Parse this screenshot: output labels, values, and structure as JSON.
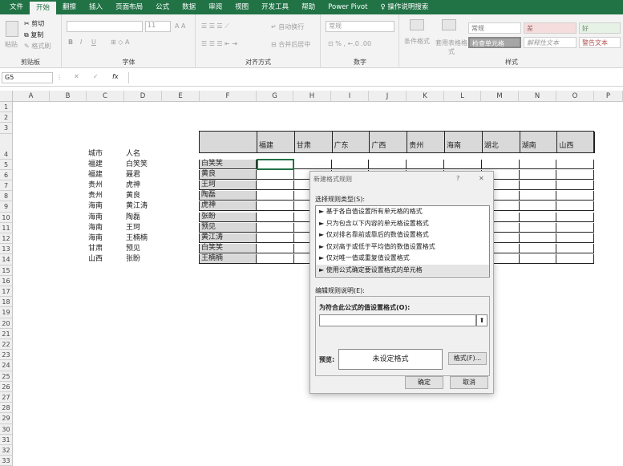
{
  "tabs": [
    "文件",
    "开始",
    "翻擦",
    "插入",
    "页面布局",
    "公式",
    "数据",
    "审阅",
    "视图",
    "开发工具",
    "帮助",
    "Power Pivot",
    "操作说明搜索"
  ],
  "clipboard": {
    "paste": "粘贴",
    "cut": "剪切",
    "copy": "复制",
    "format_painter": "格式刷",
    "label": "剪贴板"
  },
  "font": {
    "label": "字体",
    "size": "11",
    "bold": "B",
    "italic": "I",
    "underline": "U"
  },
  "alignment": {
    "label": "对齐方式",
    "wrap": "自动换行",
    "merge": "合并后居中"
  },
  "number": {
    "label": "数字",
    "format": "常规"
  },
  "styles": {
    "cond_format": "条件格式",
    "table_format": "套用表格格式",
    "label": "样式",
    "boxes": [
      "常规",
      "差",
      "好",
      "检查单元格",
      "解释性文本",
      "警告文本"
    ]
  },
  "formula_bar": {
    "name_box": "G5",
    "fx": "fx"
  },
  "columns": [
    "A",
    "B",
    "C",
    "D",
    "E",
    "F",
    "G",
    "H",
    "I",
    "J",
    "K",
    "L",
    "M",
    "N",
    "O",
    "P"
  ],
  "rows": [
    "1",
    "2",
    "3",
    "4",
    "5",
    "6",
    "7",
    "8",
    "9",
    "10",
    "11",
    "12",
    "13",
    "14",
    "15",
    "16",
    "17",
    "18",
    "19",
    "20",
    "21",
    "22",
    "23",
    "24",
    "25",
    "26",
    "27",
    "28",
    "29",
    "30",
    "31",
    "32",
    "33"
  ],
  "cd_header": {
    "city": "城市",
    "name": "人名"
  },
  "cd_rows": [
    [
      "福建",
      "白笑笑"
    ],
    [
      "福建",
      "聂君"
    ],
    [
      "贵州",
      "虎神"
    ],
    [
      "贵州",
      "黄良"
    ],
    [
      "海南",
      "黄江涛"
    ],
    [
      "海南",
      "陶磊"
    ],
    [
      "海南",
      "王珂"
    ],
    [
      "海南",
      "王楠楠"
    ],
    [
      "甘肃",
      "预见"
    ],
    [
      "山西",
      "张盼"
    ]
  ],
  "matrix_header": [
    "福建",
    "甘肃",
    "广东",
    "广西",
    "贵州",
    "海南",
    "湖北",
    "湖南",
    "山西"
  ],
  "matrix_names": [
    "白笑笑",
    "黄良",
    "王珂",
    "陶磊",
    "虎神",
    "张盼",
    "预见",
    "黄江涛",
    "白笑笑",
    "王楠楠"
  ],
  "dialog": {
    "title": "新建格式规则",
    "help": "?",
    "close": "✕",
    "select_type": "选择规则类型(S):",
    "rule_types": [
      "► 基于各自值设置所有单元格的格式",
      "► 只为包含以下内容的单元格设置格式",
      "► 仅对排名靠前或靠后的数值设置格式",
      "► 仅对高于或低于平均值的数值设置格式",
      "► 仅对唯一值或重复值设置格式",
      "► 使用公式确定要设置格式的单元格"
    ],
    "edit_desc": "编辑规则说明(E):",
    "formula_label": "为符合此公式的值设置格式(O):",
    "formula_value": "",
    "preview_label": "预览:",
    "preview_text": "未设定格式",
    "format_btn": "格式(F)...",
    "ok": "确定",
    "cancel": "取消"
  }
}
